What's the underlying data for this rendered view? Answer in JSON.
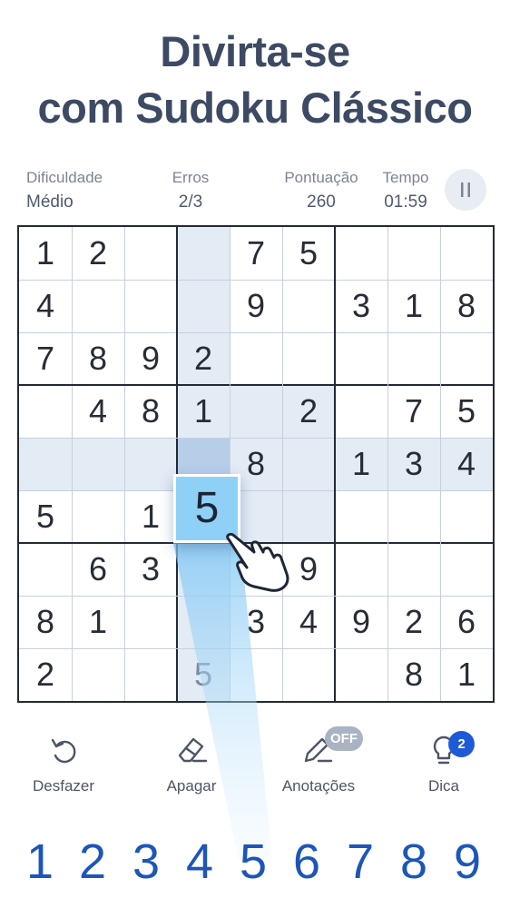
{
  "promo": {
    "line1": "Divirta-se",
    "line2": "com Sudoku Clássico"
  },
  "stats": {
    "difficulty_label": "Dificuldade",
    "difficulty_value": "Médio",
    "errors_label": "Erros",
    "errors_value": "2/3",
    "score_label": "Pontuação",
    "score_value": "260",
    "time_label": "Tempo",
    "time_value": "01:59",
    "pause_icon": "pause-icon"
  },
  "board": {
    "grid": [
      [
        1,
        2,
        0,
        0,
        7,
        5,
        0,
        0,
        0
      ],
      [
        4,
        0,
        0,
        0,
        9,
        0,
        3,
        1,
        8
      ],
      [
        7,
        8,
        9,
        2,
        0,
        0,
        0,
        0,
        0
      ],
      [
        0,
        4,
        8,
        1,
        0,
        2,
        0,
        7,
        5
      ],
      [
        0,
        0,
        0,
        0,
        8,
        0,
        1,
        3,
        4
      ],
      [
        5,
        0,
        1,
        0,
        0,
        0,
        0,
        0,
        0
      ],
      [
        0,
        6,
        3,
        0,
        0,
        9,
        0,
        0,
        0
      ],
      [
        8,
        1,
        0,
        0,
        3,
        4,
        9,
        2,
        6
      ],
      [
        2,
        0,
        0,
        5,
        0,
        0,
        0,
        8,
        1
      ]
    ],
    "faded_cells": [
      [
        8,
        3
      ]
    ],
    "selected_cell": [
      4,
      3
    ],
    "highlight_color": "#e3ebf5",
    "selected_color": "#b7cee8",
    "dragged_value": "5"
  },
  "tools": {
    "undo_label": "Desfazer",
    "erase_label": "Apagar",
    "notes_label": "Anotações",
    "notes_state": "OFF",
    "hint_label": "Dica",
    "hint_count": "2"
  },
  "numpad": [
    "1",
    "2",
    "3",
    "4",
    "5",
    "6",
    "7",
    "8",
    "9"
  ],
  "colors": {
    "accent": "#1d56b8",
    "badge": "#1d5bd6"
  }
}
